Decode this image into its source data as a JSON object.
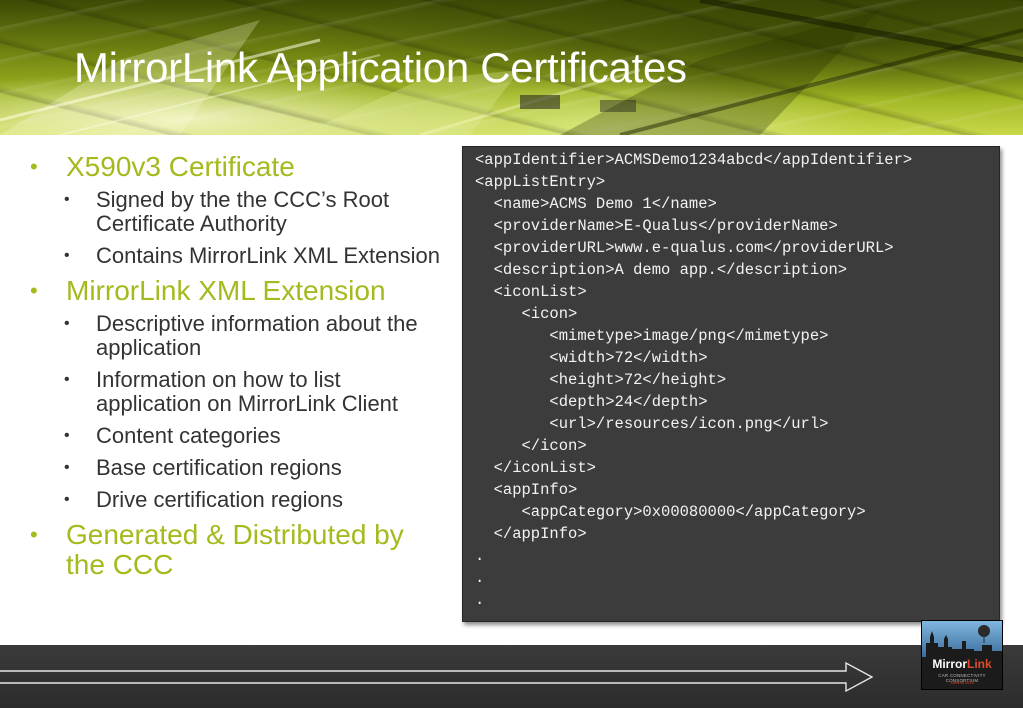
{
  "slide": {
    "title": "MirrorLink Application Certificates"
  },
  "bullets": [
    {
      "text": "X590v3 Certificate",
      "sub": [
        "Signed by the the CCC’s Root Certificate Authority",
        "Contains MirrorLink XML Extension"
      ]
    },
    {
      "text": "MirrorLink XML Extension",
      "sub": [
        "Descriptive information about the application",
        "Information on how to list application on MirrorLink Client",
        "Content categories",
        "Base certification regions",
        "Drive certification regions"
      ]
    },
    {
      "text": "Generated & Distributed by the CCC",
      "sub": []
    }
  ],
  "code": {
    "lines": [
      "<appIdentifier>ACMSDemo1234abcd</appIdentifier>",
      "<appListEntry>",
      "  <name>ACMS Demo 1</name>",
      "  <providerName>E-Qualus</providerName>",
      "  <providerURL>www.e-qualus.com</providerURL>",
      "  <description>A demo app.</description>",
      "  <iconList>",
      "     <icon>",
      "        <mimetype>image/png</mimetype>",
      "        <width>72</width>",
      "        <height>72</height>",
      "        <depth>24</depth>",
      "        <url>/resources/icon.png</url>",
      "     </icon>",
      "  </iconList>",
      "  <appInfo>",
      "     <appCategory>0x00080000</appCategory>",
      "  </appInfo>",
      ".",
      ".",
      "."
    ]
  },
  "logo": {
    "name_part1": "Mirror",
    "name_part2": "Link",
    "tagline": "CAR CONNECTIVITY CONSORTIUM",
    "event": "Summit 2013"
  },
  "colors": {
    "bullet_green": "#a6b91d",
    "code_bg": "#3c3c3c",
    "footer_bg": "#2c2c2c"
  }
}
